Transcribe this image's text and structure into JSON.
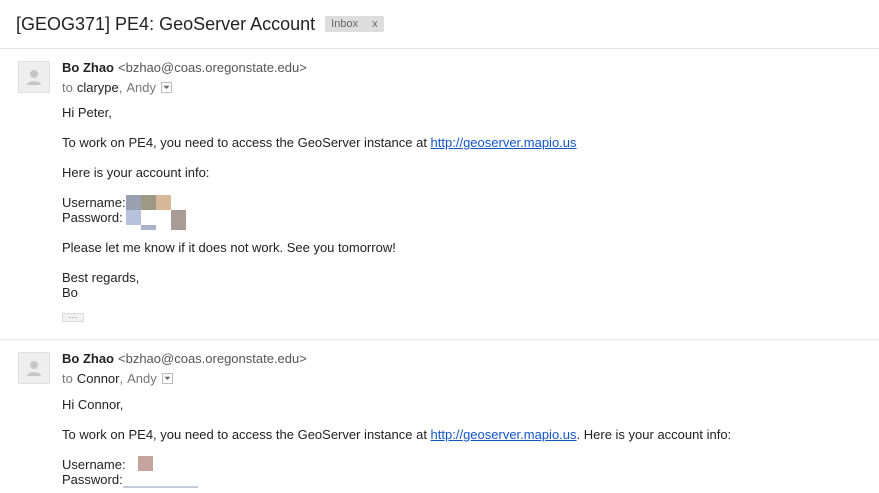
{
  "thread": {
    "subject": "[GEOG371] PE4: GeoServer Account",
    "label": "Inbox",
    "label_remove": "x"
  },
  "messages": [
    {
      "sender_name": "Bo Zhao",
      "sender_email": "<bzhao@coas.oregonstate.edu>",
      "to_prefix": "to",
      "to_first": "clarype",
      "to_comma": ",",
      "to_second": "Andy",
      "greeting": "Hi Peter,",
      "line1_pre": "To work on PE4, you need to access the GeoServer instance at ",
      "line1_link": "http://geoserver.mapio.us",
      "line2": "Here is your account info:",
      "username_label": "Username:",
      "password_label": "Password:",
      "line3": "Please let me know if it does not work. See you tomorrow!",
      "closing": "Best regards,",
      "signature": "Bo",
      "ellipsis": "···"
    },
    {
      "sender_name": "Bo Zhao",
      "sender_email": "<bzhao@coas.oregonstate.edu>",
      "to_prefix": "to",
      "to_first": "Connor",
      "to_comma": ",",
      "to_second": "Andy",
      "greeting": "Hi Connor,",
      "line1_pre": "To work on PE4, you need to access the GeoServer instance at ",
      "line1_link": "http://geoserver.mapio.us",
      "line1_post": ". Here is your account info:",
      "username_label": "Username:",
      "password_label": "Password:"
    }
  ]
}
